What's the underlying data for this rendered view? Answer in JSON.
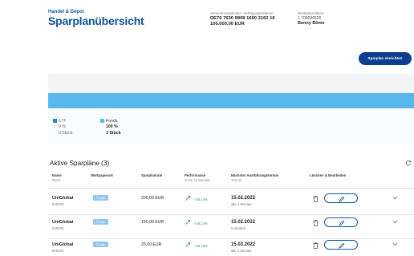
{
  "header": {
    "breadcrumb": "Handel & Depot",
    "title": "Sparplanübersicht",
    "account_label": "Verrechnungskonto / Verfügungsrahmen",
    "account_iban": "DE70 7630 9808 1600 2162 16",
    "account_amount": "100.000,00 EUR",
    "owner_label": "Wertpapierdepot",
    "owner_number": "1 700004526",
    "owner_name": "Benny Böme",
    "create_button": "Sparplan einrichten"
  },
  "allocation": {
    "colors": {
      "etf": "#1a8ad8",
      "fonds": "#59b8ef"
    },
    "legend": [
      {
        "label": "ETF",
        "percent": "0 %",
        "count": "0 Stück"
      },
      {
        "label": "Fonds",
        "percent": "100 %",
        "count": "3 Stück"
      }
    ]
  },
  "plans": {
    "title": "Aktive Sparpläne (3)",
    "columns": {
      "name": "Name",
      "name_sub": "WKN",
      "type": "Wertpapierart",
      "rate": "Sparplanrate",
      "perf": "Performance",
      "perf_sub": "letzte 12 Monate",
      "next": "Nächster Ausführungstermin",
      "next_sub": "Turnus",
      "actions": "Löschen & Bearbeiten"
    },
    "rows": [
      {
        "name": "UniGlobal",
        "isin": "849105",
        "type": "Fonds",
        "amount": "200,00 EUR",
        "perf": "+26,13%",
        "date": "15.02.2022",
        "freq": "alle 3 Monate"
      },
      {
        "name": "UniGlobal",
        "isin": "849105",
        "type": "Fonds",
        "amount": "150,00 EUR",
        "perf": "+26,13%",
        "date": "15.02.2022",
        "freq": "monatlich"
      },
      {
        "name": "UniGlobal",
        "isin": "849105",
        "type": "Fonds",
        "amount": "25,00 EUR",
        "perf": "+26,13%",
        "date": "15.03.2022",
        "freq": "alle 2 Monate"
      }
    ]
  }
}
